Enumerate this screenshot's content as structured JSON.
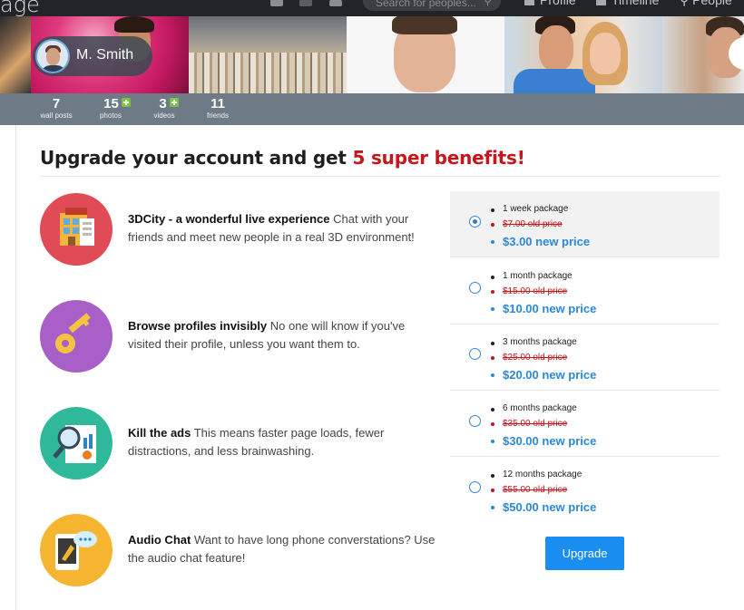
{
  "topnav": {
    "logo_fragment": "age",
    "search_placeholder": "Search for peoples...",
    "links": [
      "Profile",
      "Timeline",
      "People"
    ]
  },
  "profile": {
    "name": "M. Smith"
  },
  "stats": [
    {
      "value": "7",
      "label": "wall posts"
    },
    {
      "value": "15",
      "label": "photos"
    },
    {
      "value": "3",
      "label": "videos"
    },
    {
      "value": "11",
      "label": "friends"
    }
  ],
  "upgrade": {
    "headline_prefix": "Upgrade your account and get ",
    "headline_highlight": "5 super benefits!",
    "benefits": [
      {
        "title": "3DCity - a wonderful live experience",
        "text": " Chat with your friends and meet new people in a real 3D environment!",
        "icon": "city-building-icon",
        "color": "#e04b55"
      },
      {
        "title": "Browse profiles invisibly",
        "text": " No one will know if you've visited their profile, unless you want them to.",
        "icon": "key-icon",
        "color": "#a860c8"
      },
      {
        "title": "Kill the ads",
        "text": " This means faster page loads, fewer distractions, and less brainwashing.",
        "icon": "magnifier-report-icon",
        "color": "#2fb99a"
      },
      {
        "title": "Audio Chat",
        "text": " Want to have long phone converstations? Use the audio chat feature!",
        "icon": "phone-chat-icon",
        "color": "#f6b530"
      }
    ],
    "packages": [
      {
        "name": "1 week package",
        "old_price": "$7.00 old price",
        "new_price": "$3.00 new price",
        "selected": true
      },
      {
        "name": "1 month package",
        "old_price": "$15.00 old price",
        "new_price": "$10.00 new price",
        "selected": false
      },
      {
        "name": "3 months package",
        "old_price": "$25.00 old price",
        "new_price": "$20.00 new price",
        "selected": false
      },
      {
        "name": "6 months package",
        "old_price": "$35.00 old price",
        "new_price": "$30.00 new price",
        "selected": false
      },
      {
        "name": "12 months package",
        "old_price": "$55.00 old price",
        "new_price": "$50.00 new price",
        "selected": false
      }
    ],
    "button_label": "Upgrade",
    "colors": {
      "accent": "#1a8ef0",
      "highlight": "#c4161c",
      "new_price": "#2b88d8"
    }
  }
}
